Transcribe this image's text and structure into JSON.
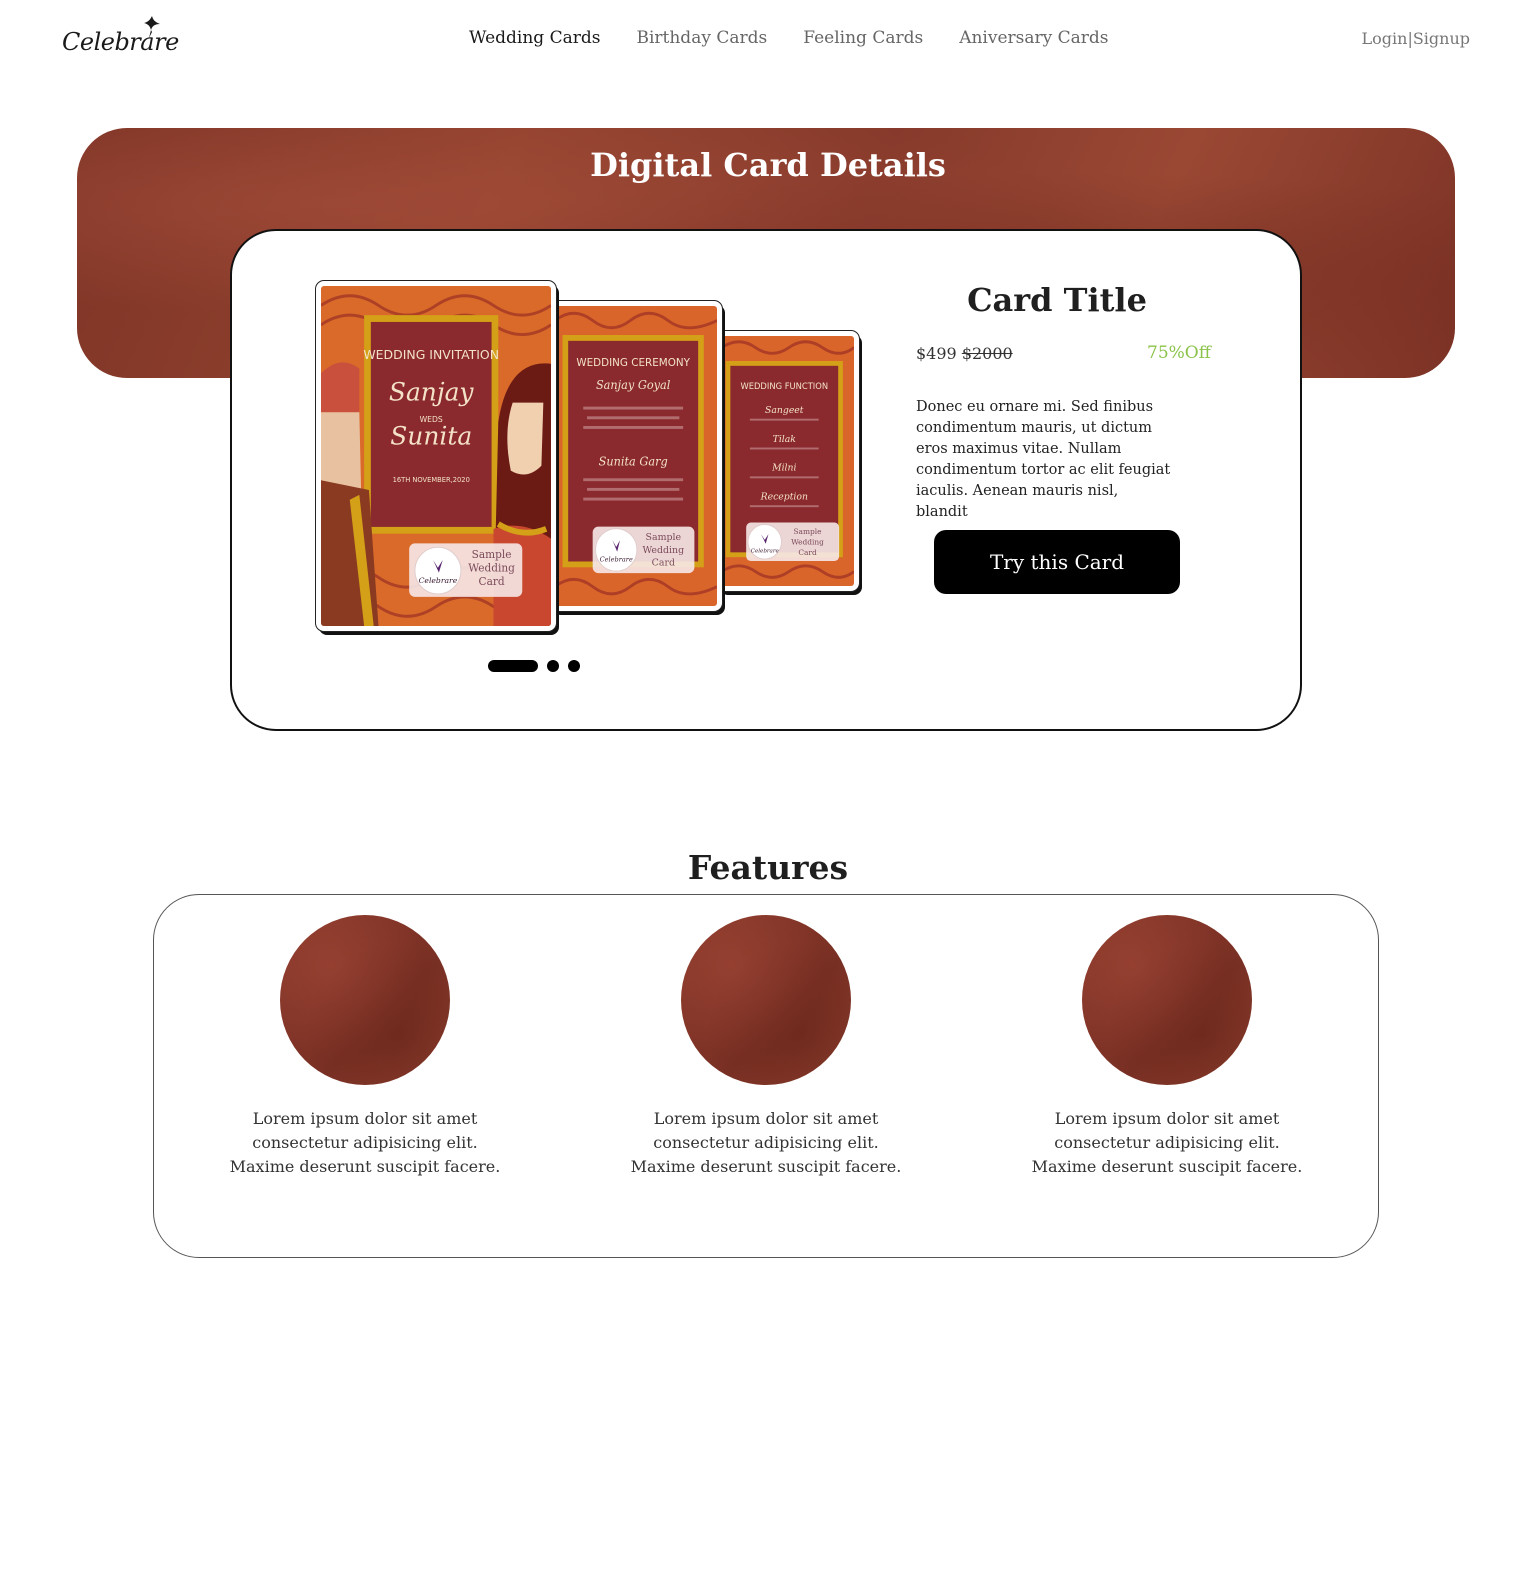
{
  "header": {
    "logo_text": "Celebrare",
    "nav": [
      {
        "label": "Wedding Cards",
        "active": true
      },
      {
        "label": "Birthday Cards",
        "active": false
      },
      {
        "label": "Feeling Cards",
        "active": false
      },
      {
        "label": "Aniversary Cards",
        "active": false
      }
    ],
    "auth": "Login|Signup"
  },
  "hero": {
    "title": "Digital Card Details",
    "background_color": "#8a3a2b"
  },
  "detail": {
    "card_title": "Card Title",
    "price": "$499",
    "old_price": "$2000",
    "discount": "75%Off",
    "discount_color": "#8bc34a",
    "description": "Donec eu ornare mi. Sed finibus condimentum mauris, ut dictum eros maximus vitae. Nullam condimentum tortor ac elit feugiat iaculis. Aenean mauris nisl, blandit",
    "button": "Try this Card",
    "carousel_slide_count": 3,
    "carousel_active_index": 0,
    "thumbnails": [
      {
        "heading": "WEDDING INVITATION",
        "name1": "Sanjay",
        "weds": "WEDS",
        "name2": "Sunita",
        "date": "16TH NOVEMBER,2020",
        "watermark_brand": "Celebrare",
        "watermark_lines": [
          "Sample",
          "Wedding",
          "Card"
        ]
      },
      {
        "heading": "WEDDING CEREMONY",
        "name1": "Sanjay Goyal",
        "name2": "Sunita Garg",
        "watermark_brand": "Celebrare",
        "watermark_lines": [
          "Sample",
          "Wedding",
          "Card"
        ]
      },
      {
        "heading": "WEDDING FUNCTION",
        "events": [
          "Sangeet",
          "Tilak",
          "Milni",
          "Reception"
        ],
        "watermark_brand": "Celebrare",
        "watermark_lines": [
          "Sample",
          "Wedding",
          "Card"
        ]
      }
    ]
  },
  "features": {
    "title": "Features",
    "items": [
      {
        "text": "Lorem ipsum dolor sit amet consectetur adipisicing elit. Maxime deserunt suscipit facere."
      },
      {
        "text": "Lorem ipsum dolor sit amet consectetur adipisicing elit. Maxime deserunt suscipit facere."
      },
      {
        "text": "Lorem ipsum dolor sit amet consectetur adipisicing elit. Maxime deserunt suscipit facere."
      }
    ]
  }
}
